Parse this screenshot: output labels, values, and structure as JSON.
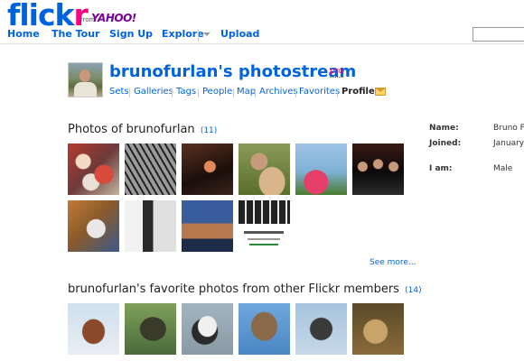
{
  "header": {
    "logo_main": "flick",
    "logo_accent": "r",
    "from_text": "from",
    "yahoo_text": "YAHOO!"
  },
  "nav": {
    "items": [
      "Home",
      "The Tour",
      "Sign Up",
      "Explore",
      "Upload"
    ]
  },
  "profile": {
    "title": "brunofurlan's photostream",
    "pro_badge": "pro",
    "subnav": [
      "Sets",
      "Galleries",
      "Tags",
      "People",
      "Map",
      "Archives",
      "Favorites",
      "Profile"
    ],
    "active_subnav": "Profile"
  },
  "photos_section": {
    "title": "Photos of brunofurlan",
    "count": "(11)",
    "see_more": "See more..."
  },
  "favorites_section": {
    "title": "brunofurlan's favorite photos from other Flickr members",
    "count": "(14)"
  },
  "info": {
    "name_label": "Name:",
    "name_value": "Bruno F",
    "joined_label": "Joined:",
    "joined_value": "January",
    "iam_label": "I am:",
    "iam_value": "Male"
  },
  "colors": {
    "link_blue": "#0063dc",
    "flickr_pink": "#ff0084"
  }
}
